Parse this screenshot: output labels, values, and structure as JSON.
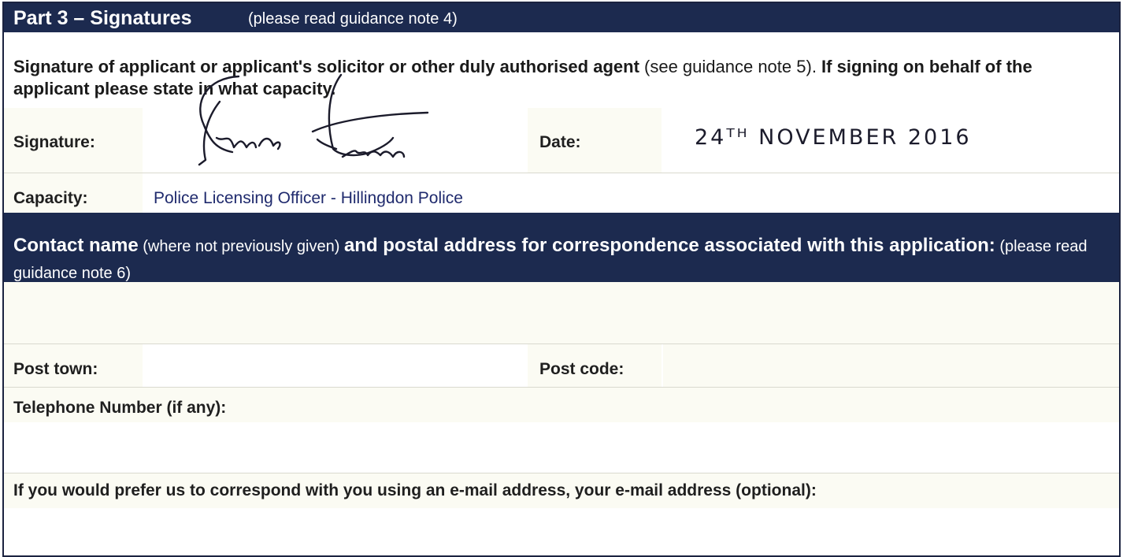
{
  "part3": {
    "title": "Part 3 – Signatures",
    "note": "(please read guidance note 4)"
  },
  "signature_block": {
    "intro_bold_1": "Signature of applicant or applicant's solicitor or other duly authorised agent",
    "intro_normal": " (see guidance note 5). ",
    "intro_bold_2": "If signing on behalf  of the applicant please state in what capacity.",
    "signature_label": "Signature:",
    "date_label": "Date:",
    "date_value": "24ᵀᴴ NOVEMBER 2016",
    "capacity_label": "Capacity:",
    "capacity_value": "Police Licensing Officer - Hillingdon Police"
  },
  "contact": {
    "heading_bold_1": "Contact name",
    "heading_normal_1": " (where not previously given) ",
    "heading_bold_2": "and postal address for correspondence associated with this application:",
    "heading_normal_2": " (please read guidance note 6)",
    "post_town_label": "Post town:",
    "post_code_label": "Post code:",
    "telephone_label": "Telephone Number (if any):",
    "email_label": "If you would prefer us to correspond with you using an e-mail address, your e-mail address (optional):"
  },
  "colors": {
    "band": "#1c2a4f",
    "capacity_text": "#1f2a6d"
  }
}
